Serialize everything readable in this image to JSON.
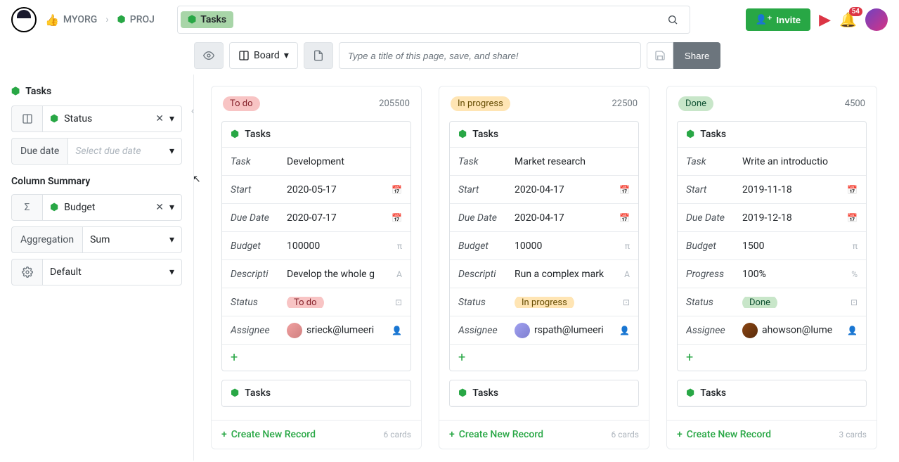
{
  "breadcrumb": {
    "org": "MYORG",
    "project": "PROJ"
  },
  "search_pill": "Tasks",
  "header": {
    "invite": "Invite",
    "notification_count": "54"
  },
  "toolbar": {
    "view_label": "Board",
    "title_placeholder": "Type a title of this page, save, and share!",
    "share": "Share"
  },
  "sidebar": {
    "title": "Tasks",
    "group_field": "Status",
    "due_date_label": "Due date",
    "due_date_placeholder": "Select due date",
    "summary_heading": "Column Summary",
    "summary_field": "Budget",
    "aggregation_label": "Aggregation",
    "aggregation_value": "Sum",
    "format_value": "Default"
  },
  "board": {
    "columns": [
      {
        "status": "To do",
        "pill_class": "pill-todo",
        "sum": "205500",
        "card": {
          "title": "Tasks",
          "fields": [
            {
              "label": "Task",
              "value": "Development",
              "icon": ""
            },
            {
              "label": "Start",
              "value": "2020-05-17",
              "icon": "📅"
            },
            {
              "label": "Due Date",
              "value": "2020-07-17",
              "icon": "📅"
            },
            {
              "label": "Budget",
              "value": "100000",
              "icon": "π"
            },
            {
              "label": "Descripti",
              "value": "Develop the whole g",
              "icon": "A"
            },
            {
              "label": "Status",
              "value": "To do",
              "pill": "pill-todo",
              "icon": "⊡"
            },
            {
              "label": "Assignee",
              "value": "srieck@lumeeri",
              "avatar": "av1",
              "icon": "👤"
            }
          ]
        },
        "second_title": "Tasks",
        "footer_count": "6 cards"
      },
      {
        "status": "In progress",
        "pill_class": "pill-progress",
        "sum": "22500",
        "card": {
          "title": "Tasks",
          "fields": [
            {
              "label": "Task",
              "value": "Market research",
              "icon": ""
            },
            {
              "label": "Start",
              "value": "2020-04-17",
              "icon": "📅"
            },
            {
              "label": "Due Date",
              "value": "2020-04-17",
              "icon": "📅"
            },
            {
              "label": "Budget",
              "value": "10000",
              "icon": "π"
            },
            {
              "label": "Descripti",
              "value": "Run a complex mark",
              "icon": "A"
            },
            {
              "label": "Status",
              "value": "In progress",
              "pill": "pill-progress",
              "icon": "⊡"
            },
            {
              "label": "Assignee",
              "value": "rspath@lumeeri",
              "avatar": "av2",
              "icon": "👤"
            }
          ]
        },
        "second_title": "Tasks",
        "footer_count": "6 cards"
      },
      {
        "status": "Done",
        "pill_class": "pill-done",
        "sum": "4500",
        "card": {
          "title": "Tasks",
          "fields": [
            {
              "label": "Task",
              "value": "Write an introductio",
              "icon": ""
            },
            {
              "label": "Start",
              "value": "2019-11-18",
              "icon": "📅"
            },
            {
              "label": "Due Date",
              "value": "2019-12-18",
              "icon": "📅"
            },
            {
              "label": "Budget",
              "value": "1500",
              "icon": "π"
            },
            {
              "label": "Progress",
              "value": "100%",
              "icon": "%"
            },
            {
              "label": "Status",
              "value": "Done",
              "pill": "pill-done",
              "icon": "⊡"
            },
            {
              "label": "Assignee",
              "value": "ahowson@lume",
              "avatar": "av3",
              "icon": "👤"
            }
          ]
        },
        "second_title": "Tasks",
        "footer_count": "3 cards"
      }
    ],
    "create_label": "Create New Record"
  }
}
